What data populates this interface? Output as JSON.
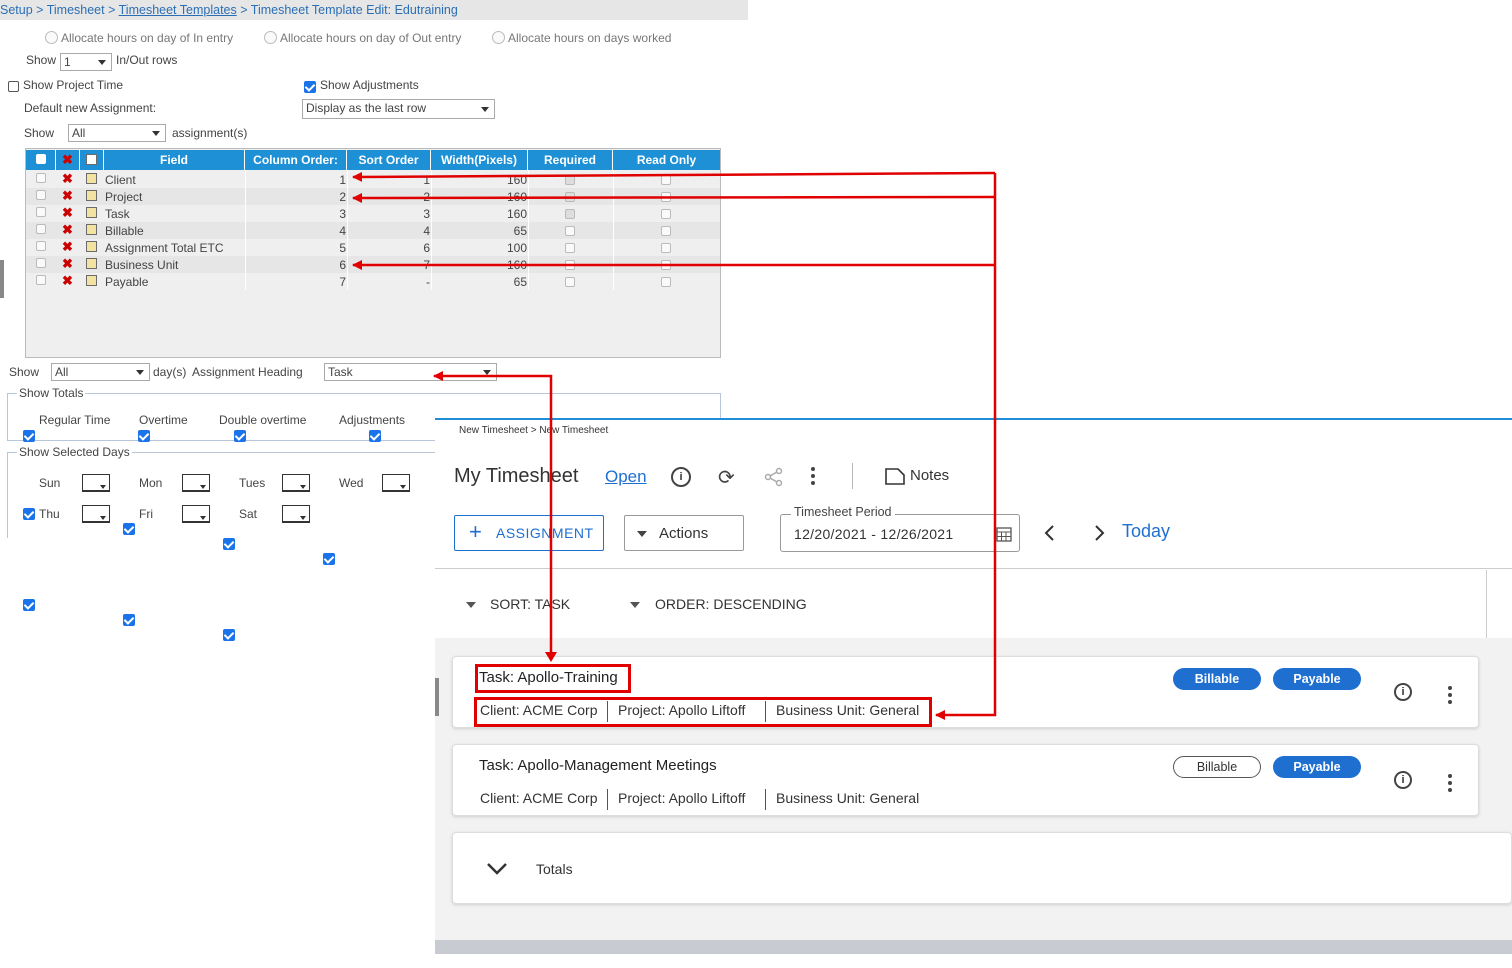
{
  "setup": {
    "breadcrumb": {
      "setup": "Setup",
      "sep1": " > ",
      "timesheet": "Timesheet",
      "sep2": " > ",
      "templates": "Timesheet Templates",
      "sep3": " > ",
      "current": "Timesheet Template Edit: Edutraining"
    },
    "allocate_options": [
      "Allocate hours on day of In entry",
      "Allocate hours on day of Out entry",
      "Allocate hours on days worked"
    ],
    "show_label": "Show",
    "inout_value": "1",
    "inout_suffix": "In/Out rows",
    "show_project_time": "Show Project Time",
    "show_adjustments": "Show Adjustments",
    "default_new_assignment_label": "Default new Assignment:",
    "default_new_assignment_value": "Display as the last row",
    "assignments_value": "All",
    "assignments_suffix": "assignment(s)",
    "grid": {
      "headers": [
        "Field",
        "Column Order:",
        "Sort Order",
        "Width(Pixels)",
        "Required",
        "Read Only"
      ],
      "rows": [
        {
          "field": "Client",
          "col": "1",
          "sort": "1",
          "width": "160"
        },
        {
          "field": "Project",
          "col": "2",
          "sort": "2",
          "width": "160"
        },
        {
          "field": "Task",
          "col": "3",
          "sort": "3",
          "width": "160"
        },
        {
          "field": "Billable",
          "col": "4",
          "sort": "4",
          "width": "65"
        },
        {
          "field": "Assignment Total ETC",
          "col": "5",
          "sort": "6",
          "width": "100"
        },
        {
          "field": "Business Unit",
          "col": "6",
          "sort": "7",
          "width": "160"
        },
        {
          "field": "Payable",
          "col": "7",
          "sort": "-",
          "width": "65"
        }
      ]
    },
    "days_show_value": "All",
    "days_suffix": "day(s)",
    "assignment_heading_label": "Assignment Heading",
    "assignment_heading_value": "Task",
    "show_totals_legend": "Show Totals",
    "totals": [
      "Regular Time",
      "Overtime",
      "Double overtime",
      "Adjustments"
    ],
    "show_selected_days_legend": "Show Selected Days",
    "days": [
      "Sun",
      "Mon",
      "Tues",
      "Wed",
      "Thu",
      "Fri",
      "Sat"
    ]
  },
  "timesheet": {
    "breadcrumb": "New Timesheet > New Timesheet",
    "title": "My Timesheet",
    "status": "Open",
    "notes_label": "Notes",
    "assignment_button": "ASSIGNMENT",
    "actions_button": "Actions",
    "period_label": "Timesheet Period",
    "period_value": "12/20/2021 - 12/26/2021",
    "today_label": "Today",
    "sort_label": "SORT: TASK",
    "order_label": "ORDER: DESCENDING",
    "cards": [
      {
        "title": "Task: Apollo-Training",
        "client": "Client: ACME Corp",
        "project": "Project: Apollo Liftoff",
        "business_unit": "Business Unit: General",
        "billable": "Billable",
        "payable": "Payable"
      },
      {
        "title": "Task: Apollo-Management Meetings",
        "client": "Client: ACME Corp",
        "project": "Project: Apollo Liftoff",
        "business_unit": "Business Unit: General",
        "billable": "Billable",
        "payable": "Payable"
      }
    ],
    "totals_label": "Totals"
  },
  "colors": {
    "accent": "#1f6fd0",
    "grid_header": "#1e90d6",
    "annotation": "#e00000"
  }
}
